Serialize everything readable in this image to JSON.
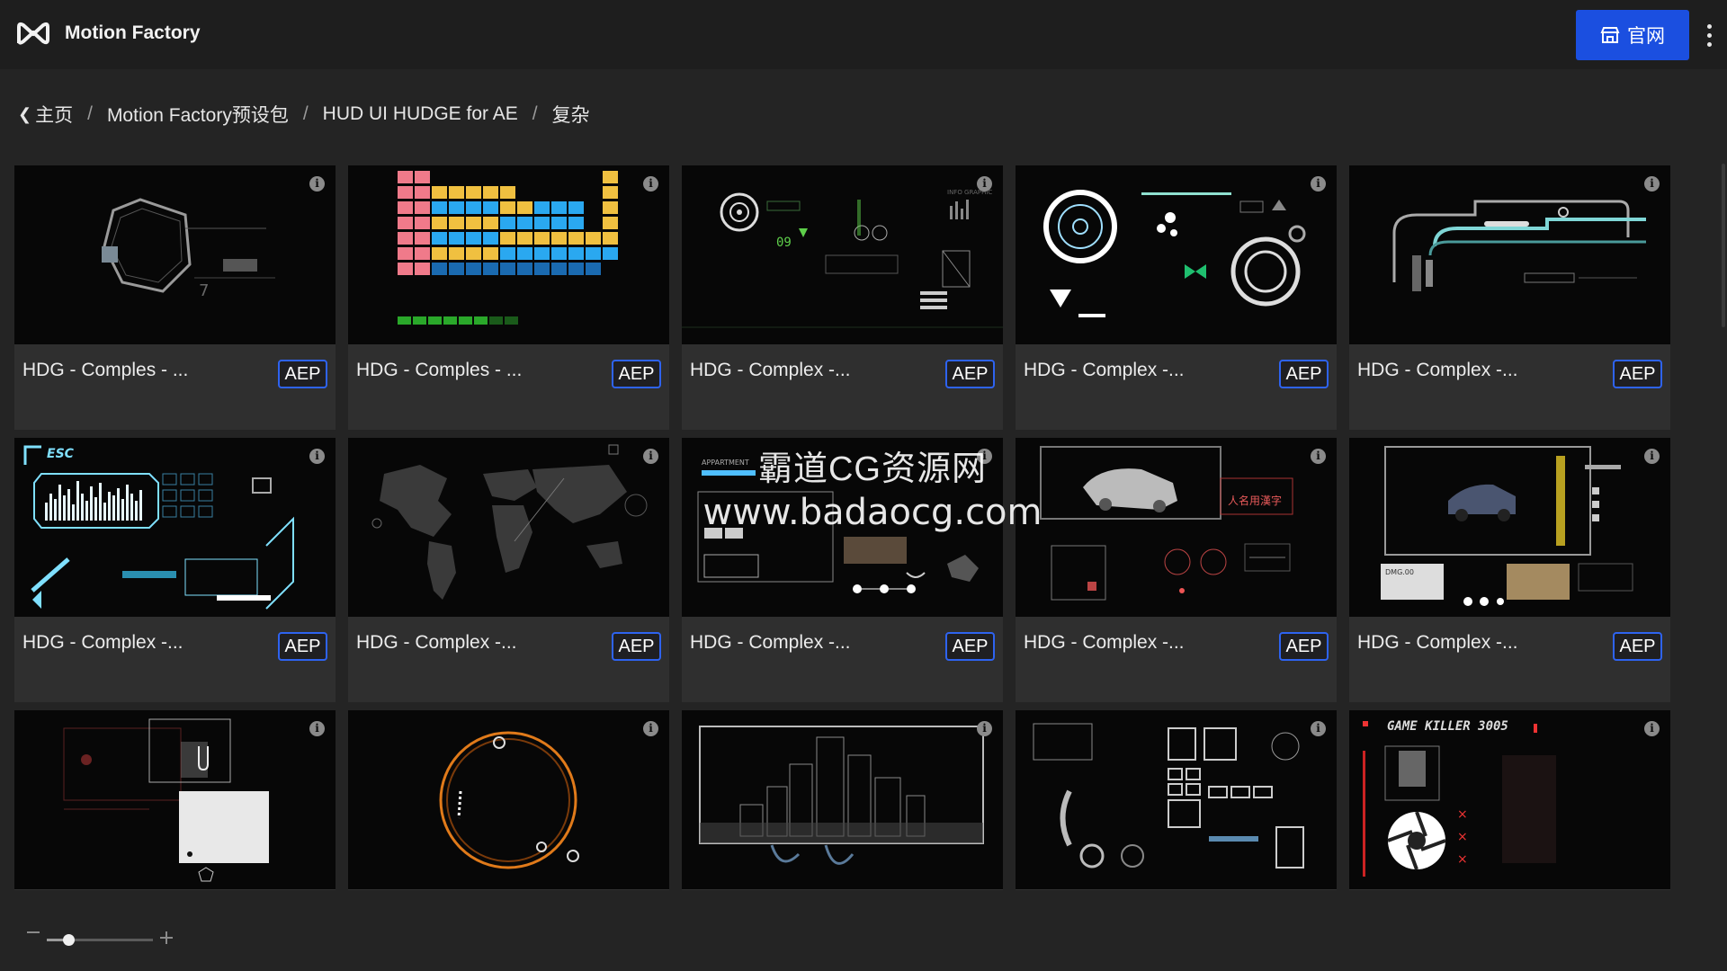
{
  "app": {
    "name": "Motion Factory",
    "site_button": "官网"
  },
  "breadcrumb": [
    {
      "label": "主页"
    },
    {
      "label": "Motion Factory预设包"
    },
    {
      "label": "HUD UI HUDGE for AE"
    },
    {
      "label": "复杂"
    }
  ],
  "cards": [
    {
      "title": "HDG - Comples - ...",
      "badge": "AEP"
    },
    {
      "title": "HDG - Comples - ...",
      "badge": "AEP"
    },
    {
      "title": "HDG - Complex -...",
      "badge": "AEP"
    },
    {
      "title": "HDG - Complex -...",
      "badge": "AEP"
    },
    {
      "title": "HDG - Complex -...",
      "badge": "AEP"
    },
    {
      "title": "HDG - Complex -...",
      "badge": "AEP"
    },
    {
      "title": "HDG - Complex -...",
      "badge": "AEP"
    },
    {
      "title": "HDG - Complex -...",
      "badge": "AEP"
    },
    {
      "title": "HDG - Complex -...",
      "badge": "AEP"
    },
    {
      "title": "HDG - Complex -...",
      "badge": "AEP"
    },
    {
      "title": "",
      "badge": ""
    },
    {
      "title": "",
      "badge": ""
    },
    {
      "title": "",
      "badge": ""
    },
    {
      "title": "",
      "badge": ""
    },
    {
      "title": "",
      "badge": ""
    }
  ],
  "thumb_text": {
    "t2_info": "INFO GRAPHIC",
    "t2_num": "09",
    "t7_label": "APPARTMENT",
    "t8_label": "人名用漢字",
    "t9_label": "DMG.00",
    "t14_label": "GAME KILLER 3005",
    "t5_label": "ESC"
  },
  "zoom": {
    "level": 0.2
  },
  "watermark": {
    "line1": "霸道CG资源网",
    "line2": "www.badaocg.com"
  },
  "colors": {
    "accent": "#1b4fe0",
    "badge_border": "#2e63f0",
    "bg": "#242424",
    "header": "#1e1e1e",
    "card": "#2f2f2f"
  }
}
